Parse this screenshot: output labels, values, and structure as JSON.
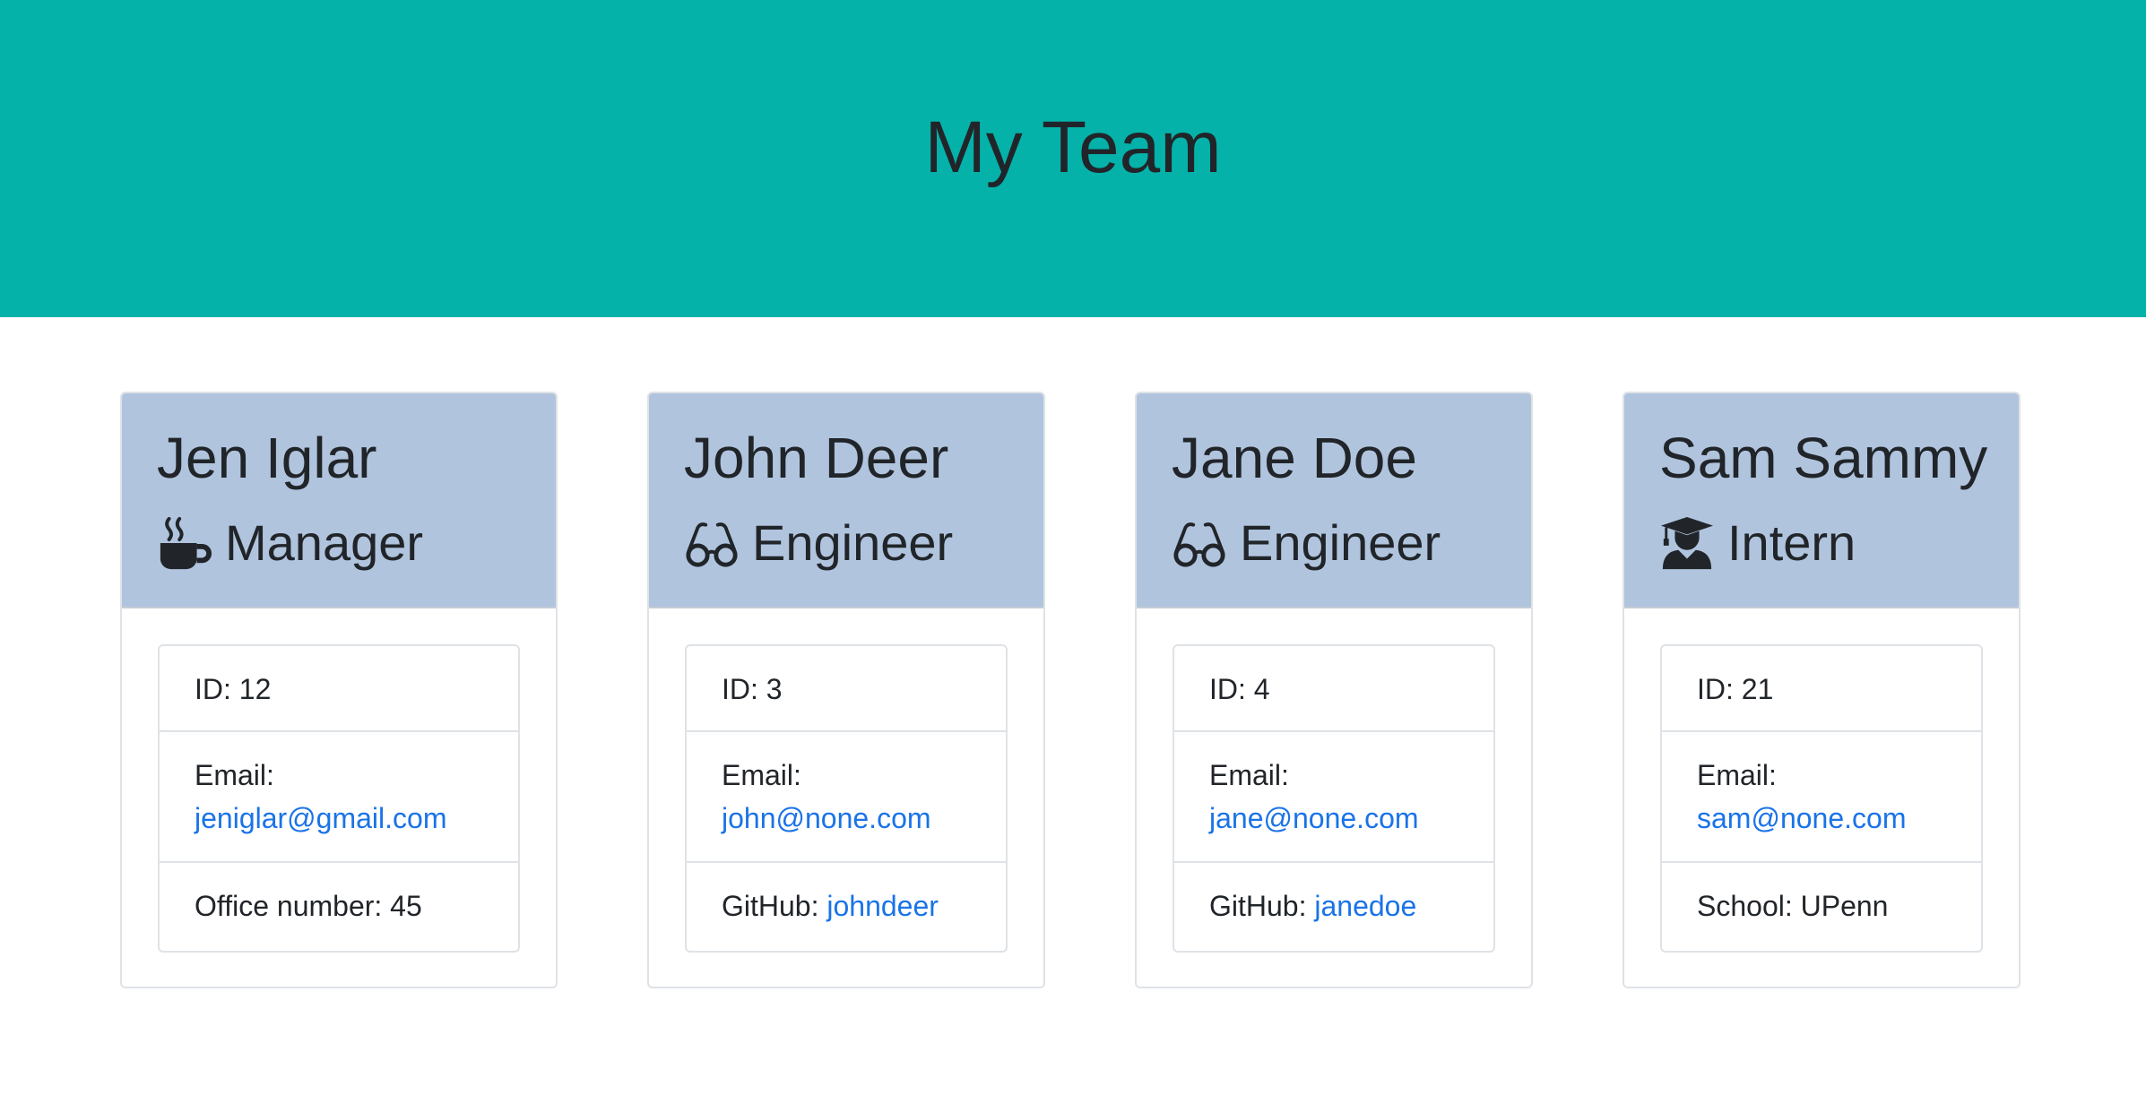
{
  "header": {
    "title": "My Team"
  },
  "members": [
    {
      "name": "Jen Iglar",
      "role": "Manager",
      "icon": "coffee-mug-icon",
      "id_label": "ID: 12",
      "email_label": "Email:",
      "email": "jeniglar@gmail.com",
      "extra_label": "Office number: 45",
      "extra_value": ""
    },
    {
      "name": "John Deer",
      "role": "Engineer",
      "icon": "glasses-icon",
      "id_label": "ID: 3",
      "email_label": "Email:",
      "email": "john@none.com",
      "extra_label": "GitHub: ",
      "extra_value": "johndeer"
    },
    {
      "name": "Jane Doe",
      "role": "Engineer",
      "icon": "glasses-icon",
      "id_label": "ID: 4",
      "email_label": "Email:",
      "email": "jane@none.com",
      "extra_label": "GitHub: ",
      "extra_value": "janedoe"
    },
    {
      "name": "Sam Sammy",
      "role": "Intern",
      "icon": "graduate-icon",
      "id_label": "ID: 21",
      "email_label": "Email:",
      "email": "sam@none.com",
      "extra_label": "School: UPenn",
      "extra_value": ""
    }
  ],
  "colors": {
    "hero_bg": "#04b2aa",
    "card_header_bg": "#b0c4de",
    "link": "#1a73e8"
  }
}
